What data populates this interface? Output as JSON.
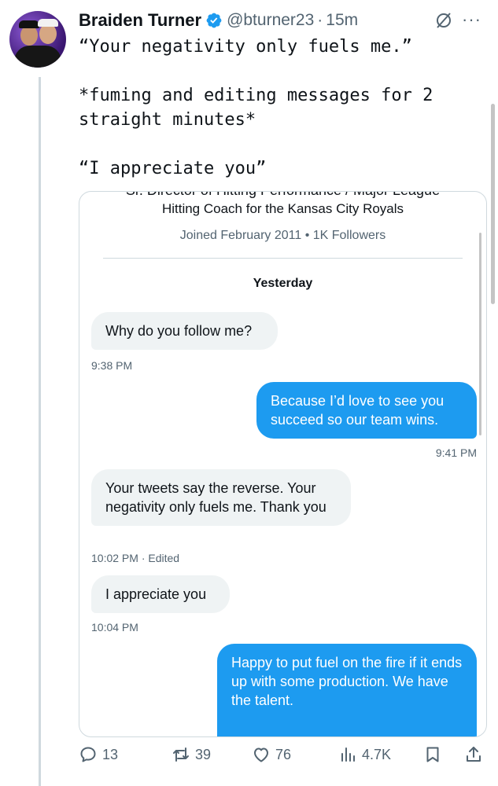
{
  "author": {
    "name": "Braiden Turner",
    "handle": "@bturner23",
    "separator": "·",
    "age": "15m",
    "more": "···"
  },
  "tweet": {
    "text": "“Your negativity only fuels me.”\n\n*fuming and editing messages for 2 straight minutes*\n\n“I appreciate you”"
  },
  "screenshot": {
    "bio_cut": "Sr. Director of Hitting Performance / Major League",
    "bio": "Hitting Coach for the Kansas City Royals",
    "joined": "Joined February 2011 • 1K Followers",
    "date_divider": "Yesterday",
    "messages": [
      {
        "from": "received",
        "text": "Why do you follow me?",
        "time": "9:38 PM"
      },
      {
        "from": "sent",
        "text": "Because I’d love to see you succeed so our team wins.",
        "time": "9:41 PM"
      },
      {
        "from": "received",
        "text": "Your tweets say the reverse. Your negativity only fuels me. Thank you",
        "time": "10:02 PM · Edited"
      },
      {
        "from": "received",
        "text": "I appreciate you",
        "time": "10:04 PM"
      },
      {
        "from": "sent",
        "text": "Happy to put fuel on the fire if it ends up with some production. We have the talent.",
        "time": ""
      }
    ]
  },
  "actions": {
    "replies": "13",
    "reposts": "39",
    "likes": "76",
    "views": "4.7K"
  },
  "colors": {
    "accent": "#1d9bf0",
    "secondary_text": "#536471",
    "bubble_received": "#eff3f4"
  },
  "icons": [
    "verified-badge-icon",
    "grok-icon",
    "more-icon",
    "reply-icon",
    "repost-icon",
    "like-icon",
    "views-icon",
    "bookmark-icon",
    "share-icon"
  ]
}
